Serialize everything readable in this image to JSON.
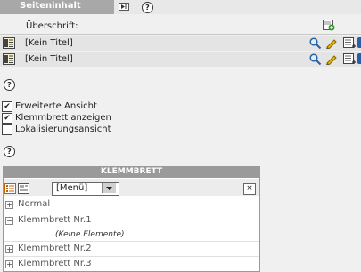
{
  "header": {
    "title": "Seiteninhalt"
  },
  "ueberschrift": {
    "label": "Überschrift:"
  },
  "records": [
    {
      "title": "[Kein Titel]"
    },
    {
      "title": "[Kein Titel]"
    }
  ],
  "options": {
    "extended_view": {
      "label": "Erweiterte Ansicht",
      "checked": true
    },
    "clipboard": {
      "label": "Klemmbrett anzeigen",
      "checked": true
    },
    "localization": {
      "label": "Lokalisierungsansicht",
      "checked": false
    }
  },
  "clipboard_panel": {
    "title": "KLEMMBRETT",
    "menu_value": "[Menü]",
    "close_glyph": "×",
    "items": [
      {
        "label": "Normal",
        "expander": "+"
      },
      {
        "label": "Klemmbrett Nr.1",
        "expander": "−"
      },
      {
        "label": "Klemmbrett Nr.2",
        "expander": "+"
      },
      {
        "label": "Klemmbrett Nr.3",
        "expander": "+"
      }
    ],
    "empty_note": "(Keine Elemente)"
  },
  "help_glyph": "?",
  "checkmark": "✔",
  "colors": {
    "header_dark": "#a8a8a8",
    "row_bg": "#e4e4e4",
    "page_bg": "#f0f0f0",
    "pencil": "#e8b400"
  }
}
